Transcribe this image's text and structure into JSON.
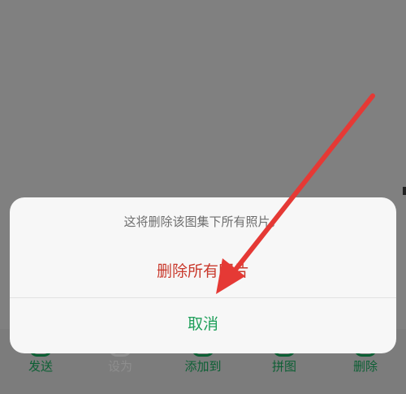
{
  "colors": {
    "overlay": "#808080",
    "sheet_background": "#f7f7f7",
    "destructive": "#c9392c",
    "cancel": "#1f9f5a",
    "toolbar_active": "#0c5f34",
    "toolbar_disabled": "#8e8e8e",
    "annotation_arrow": "#e53935"
  },
  "toolbar": {
    "items": [
      {
        "label": "发送",
        "icon": "send-icon",
        "enabled": true
      },
      {
        "label": "设为",
        "icon": "set-as-icon",
        "enabled": false
      },
      {
        "label": "添加到",
        "icon": "add-to-icon",
        "enabled": true
      },
      {
        "label": "拼图",
        "icon": "collage-icon",
        "enabled": true
      },
      {
        "label": "删除",
        "icon": "trash-icon",
        "enabled": true
      }
    ]
  },
  "dialog": {
    "message": "这将删除该图集下所有照片。",
    "delete_all_label": "删除所有照片",
    "cancel_label": "取消"
  },
  "annotation": {
    "icon": "red-arrow-pointing-to-delete-all"
  }
}
